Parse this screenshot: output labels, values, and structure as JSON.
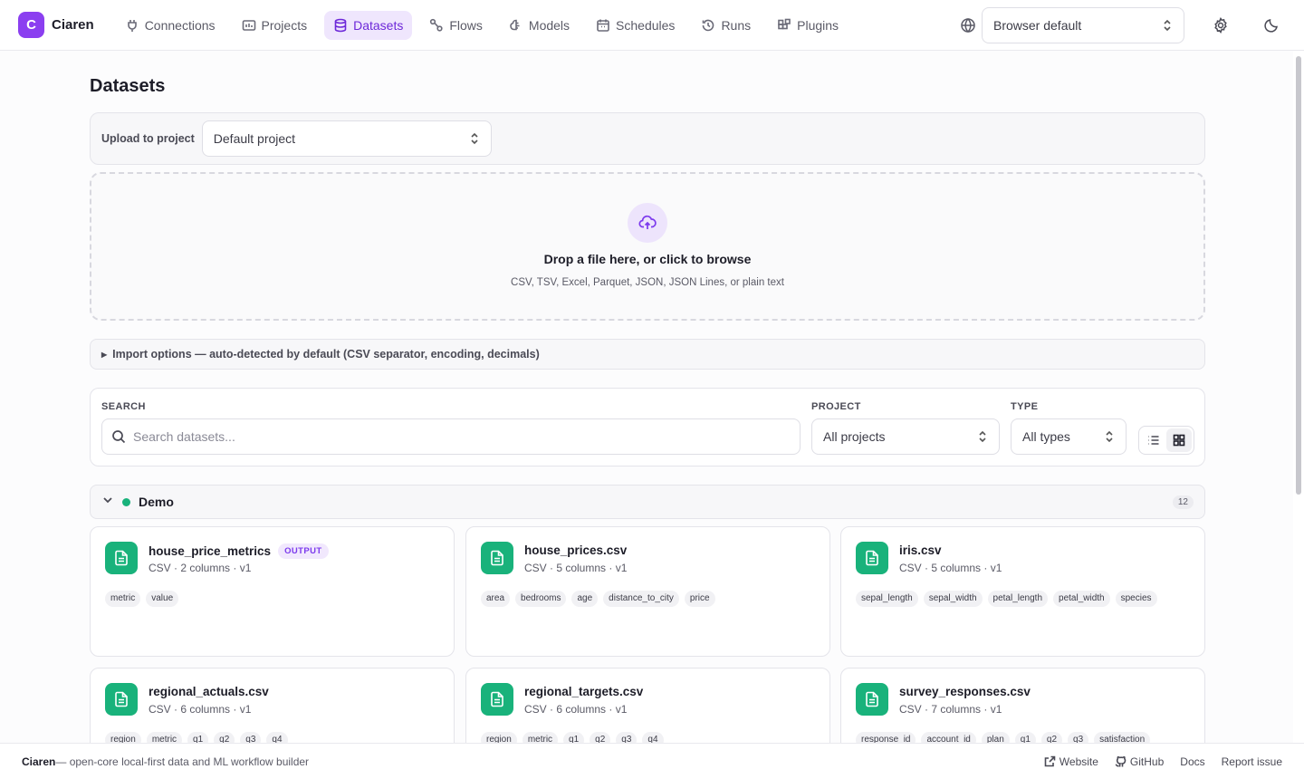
{
  "app": {
    "logo_letter": "C",
    "name": "Ciaren"
  },
  "nav": {
    "items": [
      {
        "label": "Connections",
        "icon": "plug-icon",
        "active": false
      },
      {
        "label": "Projects",
        "icon": "folder-icon",
        "active": false
      },
      {
        "label": "Datasets",
        "icon": "database-icon",
        "active": true
      },
      {
        "label": "Flows",
        "icon": "flow-icon",
        "active": false
      },
      {
        "label": "Models",
        "icon": "brain-icon",
        "active": false
      },
      {
        "label": "Schedules",
        "icon": "calendar-icon",
        "active": false
      },
      {
        "label": "Runs",
        "icon": "history-icon",
        "active": false
      },
      {
        "label": "Plugins",
        "icon": "blocks-icon",
        "active": false
      }
    ],
    "language_select": "Browser default"
  },
  "page": {
    "title": "Datasets"
  },
  "upload": {
    "label": "Upload to project",
    "project_value": "Default project",
    "drop_title": "Drop a file here, or click to browse",
    "drop_subtitle": "CSV, TSV, Excel, Parquet, JSON, JSON Lines, or plain text"
  },
  "import_options": {
    "label": "Import options — auto-detected by default (CSV separator, encoding, decimals)"
  },
  "filters": {
    "search_label": "SEARCH",
    "search_placeholder": "Search datasets...",
    "project_label": "PROJECT",
    "project_value": "All projects",
    "type_label": "TYPE",
    "type_value": "All types",
    "view_mode": "grid"
  },
  "group": {
    "name": "Demo",
    "count": "12",
    "color": "#19b27b"
  },
  "datasets": [
    {
      "name": "house_price_metrics",
      "badge": "OUTPUT",
      "meta": "CSV · 2 columns · v1",
      "tags": [
        "metric",
        "value"
      ]
    },
    {
      "name": "house_prices.csv",
      "badge": "",
      "meta": "CSV · 5 columns · v1",
      "tags": [
        "area",
        "bedrooms",
        "age",
        "distance_to_city",
        "price"
      ]
    },
    {
      "name": "iris.csv",
      "badge": "",
      "meta": "CSV · 5 columns · v1",
      "tags": [
        "sepal_length",
        "sepal_width",
        "petal_length",
        "petal_width",
        "species"
      ]
    },
    {
      "name": "regional_actuals.csv",
      "badge": "",
      "meta": "CSV · 6 columns · v1",
      "tags": [
        "region",
        "metric",
        "q1",
        "q2",
        "q3",
        "q4"
      ]
    },
    {
      "name": "regional_targets.csv",
      "badge": "",
      "meta": "CSV · 6 columns · v1",
      "tags": [
        "region",
        "metric",
        "q1",
        "q2",
        "q3",
        "q4"
      ]
    },
    {
      "name": "survey_responses.csv",
      "badge": "",
      "meta": "CSV · 7 columns · v1",
      "tags": [
        "response_id",
        "account_id",
        "plan",
        "q1",
        "q2",
        "q3",
        "satisfaction"
      ]
    }
  ],
  "footer": {
    "brand": "Ciaren",
    "tagline": " — open-core local-first data and ML workflow builder",
    "links": [
      {
        "label": "Website",
        "icon": "external-link-icon"
      },
      {
        "label": "GitHub",
        "icon": "github-icon"
      },
      {
        "label": "Docs",
        "icon": ""
      },
      {
        "label": "Report issue",
        "icon": ""
      }
    ]
  },
  "colors": {
    "accent": "#7c3aed",
    "dataset_icon": "#19b27b"
  }
}
